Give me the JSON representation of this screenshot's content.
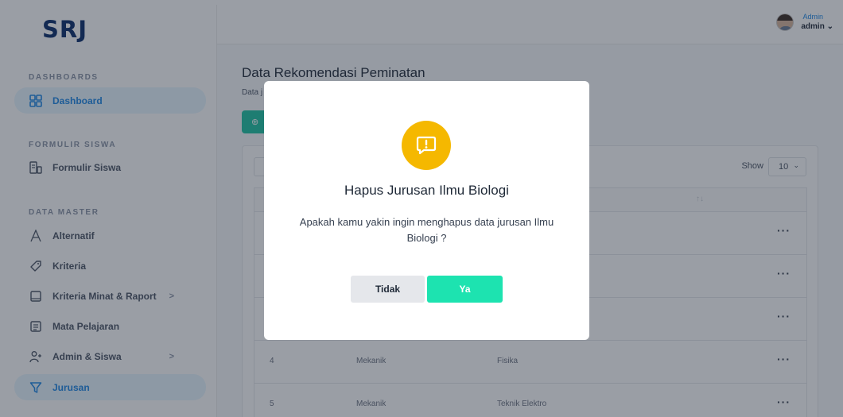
{
  "app": {
    "logo": "SRJ"
  },
  "sidebar": {
    "sections": [
      {
        "title": "DASHBOARDS"
      },
      {
        "title": "FORMULIR SISWA"
      },
      {
        "title": "DATA MASTER"
      }
    ],
    "items": [
      {
        "label": "Dashboard",
        "icon": "dashboard-grid-icon",
        "active": true
      },
      {
        "label": "Formulir Siswa",
        "icon": "form-document-icon"
      },
      {
        "label": "Alternatif",
        "icon": "letter-a-icon"
      },
      {
        "label": "Kriteria",
        "icon": "tag-icon"
      },
      {
        "label": "Kriteria Minat & Raport",
        "icon": "tablet-icon",
        "arrow": ">"
      },
      {
        "label": "Mata Pelajaran",
        "icon": "subject-list-icon"
      },
      {
        "label": "Admin & Siswa",
        "icon": "user-add-icon",
        "arrow": ">"
      },
      {
        "label": "Jurusan",
        "icon": "filter-icon",
        "active": true
      }
    ]
  },
  "header": {
    "user_role": "Admin",
    "user_name": "admin",
    "chevron": "⌄"
  },
  "main": {
    "title": "Data Rekomendasi Peminatan",
    "subtitle": "Data j",
    "add_button_icon": "⊕",
    "show_label": "Show",
    "show_value": "10",
    "sort_icon": "↑↓",
    "row_action": "···",
    "rows": [
      {
        "no": "4",
        "minat": "Mekanik",
        "mapel": "Fisika"
      },
      {
        "no": "5",
        "minat": "Mekanik",
        "mapel": "Teknik Elektro"
      }
    ]
  },
  "modal": {
    "icon": "exclamation-chat-icon",
    "title": "Hapus Jurusan Ilmu Biologi",
    "message": "Apakah kamu yakin ingin menghapus data jurusan Ilmu Biologi ?",
    "cancel_label": "Tidak",
    "confirm_label": "Ya"
  },
  "colors": {
    "primary": "#1e88e5",
    "accent": "#1ec3a3",
    "confirm": "#1de3b0",
    "warning": "#f5b800",
    "logo": "#0a2c6a"
  }
}
